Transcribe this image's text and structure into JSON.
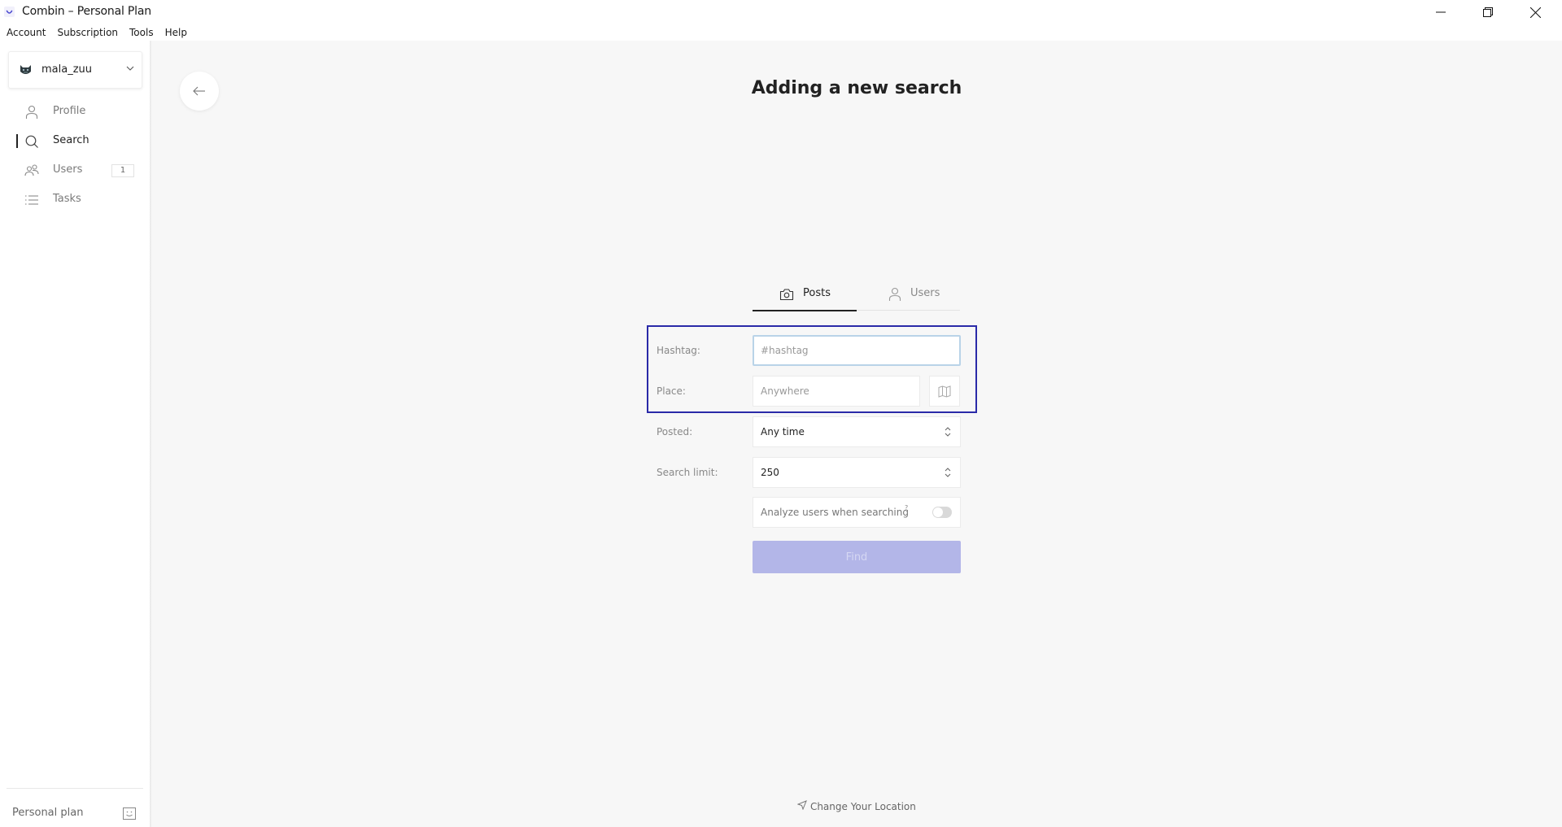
{
  "window": {
    "title": "Combin – Personal Plan",
    "controls": [
      "minimize",
      "restore",
      "close"
    ]
  },
  "menubar": {
    "items": [
      "Account",
      "Subscription",
      "Tools",
      "Help"
    ]
  },
  "sidebar": {
    "account": {
      "name": "mala_zuu",
      "avatar_icon": "cat-avatar-icon"
    },
    "items": [
      {
        "label": "Profile",
        "icon": "user-icon",
        "active": false
      },
      {
        "label": "Search",
        "icon": "search-icon",
        "active": true
      },
      {
        "label": "Users",
        "icon": "users-icon",
        "active": false,
        "badge": "1"
      },
      {
        "label": "Tasks",
        "icon": "list-icon",
        "active": false
      }
    ],
    "plan_label": "Personal plan"
  },
  "main": {
    "title": "Adding a new search",
    "tabs": [
      {
        "label": "Posts",
        "icon": "camera-icon",
        "active": true
      },
      {
        "label": "Users",
        "icon": "user-icon",
        "active": false
      }
    ],
    "form": {
      "hashtag": {
        "label": "Hashtag:",
        "placeholder": "#hashtag",
        "value": ""
      },
      "place": {
        "label": "Place:",
        "placeholder": "Anywhere",
        "value": ""
      },
      "posted": {
        "label": "Posted:",
        "value": "Any time"
      },
      "search_limit": {
        "label": "Search limit:",
        "value": "250"
      },
      "analyze_users": {
        "label": "Analyze users when searching",
        "help": "?",
        "enabled": false
      },
      "find_label": "Find"
    },
    "change_location_label": "Change Your Location"
  },
  "colors": {
    "accent_disabled": "#b3b6e8",
    "focus_frame": "#2a2aa8",
    "input_focus": "#b9d3e8",
    "background": "#f7f7f7"
  }
}
